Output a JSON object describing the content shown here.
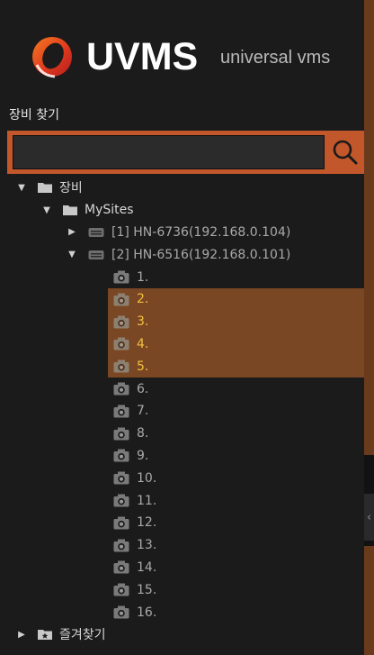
{
  "brand": {
    "name": "UVMS",
    "tagline": "universal vms"
  },
  "search": {
    "title": "장비 찾기",
    "value": "",
    "button_icon": "search-icon"
  },
  "tree": {
    "root_label": "장비",
    "site_label": "MySites",
    "recorders": [
      {
        "label": "[1] HN-6736(192.168.0.104)",
        "expanded": false
      },
      {
        "label": "[2] HN-6516(192.168.0.101)",
        "expanded": true
      }
    ],
    "channels": [
      {
        "label": "1.",
        "selected": false
      },
      {
        "label": "2.",
        "selected": true
      },
      {
        "label": "3.",
        "selected": true
      },
      {
        "label": "4.",
        "selected": true
      },
      {
        "label": "5.",
        "selected": true
      },
      {
        "label": "6.",
        "selected": false
      },
      {
        "label": "7.",
        "selected": false
      },
      {
        "label": "8.",
        "selected": false
      },
      {
        "label": "9.",
        "selected": false
      },
      {
        "label": "10.",
        "selected": false
      },
      {
        "label": "11.",
        "selected": false
      },
      {
        "label": "12.",
        "selected": false
      },
      {
        "label": "13.",
        "selected": false
      },
      {
        "label": "14.",
        "selected": false
      },
      {
        "label": "15.",
        "selected": false
      },
      {
        "label": "16.",
        "selected": false
      }
    ],
    "favorites_label": "즐겨찾기"
  },
  "colors": {
    "accent": "#c2572b",
    "selection": "#7a4724",
    "selected_text": "#f0c040",
    "background": "#1b1b1b"
  }
}
